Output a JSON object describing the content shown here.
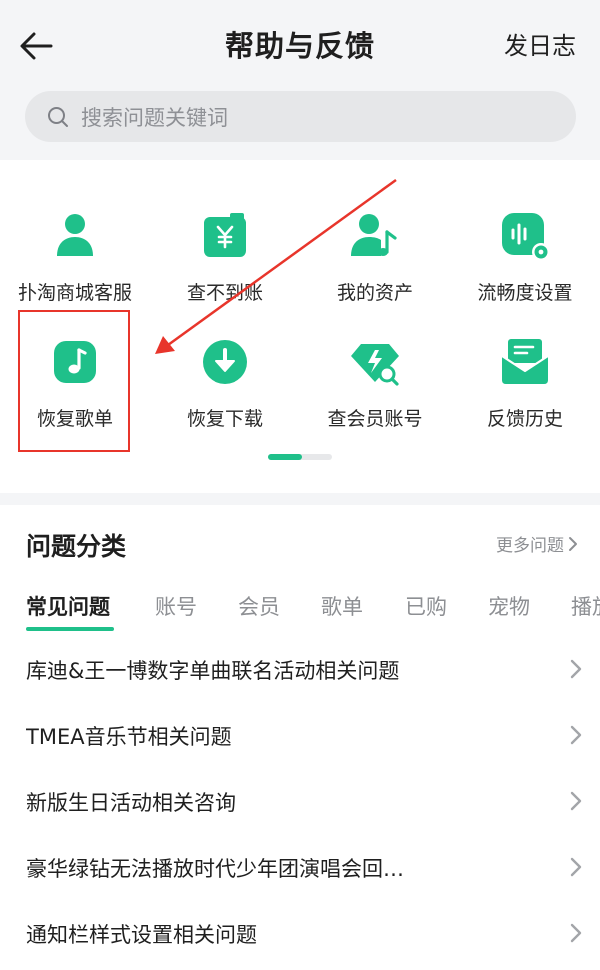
{
  "header": {
    "title": "帮助与反馈",
    "action_label": "发日志"
  },
  "search": {
    "placeholder": "搜索问题关键词"
  },
  "accent_color": "#1fc08a",
  "shortcuts": [
    {
      "label": "扑淘商城客服",
      "icon": "user-service-icon"
    },
    {
      "label": "查不到账",
      "icon": "wallet-yen-icon"
    },
    {
      "label": "我的资产",
      "icon": "user-music-icon"
    },
    {
      "label": "流畅度设置",
      "icon": "audio-settings-icon"
    },
    {
      "label": "恢复歌单",
      "icon": "music-note-icon"
    },
    {
      "label": "恢复下载",
      "icon": "download-icon"
    },
    {
      "label": "查会员账号",
      "icon": "diamond-search-icon"
    },
    {
      "label": "反馈历史",
      "icon": "mail-icon"
    }
  ],
  "categories": {
    "title": "问题分类",
    "more_label": "更多问题",
    "tabs": [
      "常见问题",
      "账号",
      "会员",
      "歌单",
      "已购",
      "宠物",
      "播放"
    ],
    "active_tab": "常见问题",
    "questions": [
      "库迪&王一博数字单曲联名活动相关问题",
      "TMEA音乐节相关问题",
      "新版生日活动相关咨询",
      "豪华绿钻无法播放时代少年团演唱会回…",
      "通知栏样式设置相关问题"
    ]
  }
}
